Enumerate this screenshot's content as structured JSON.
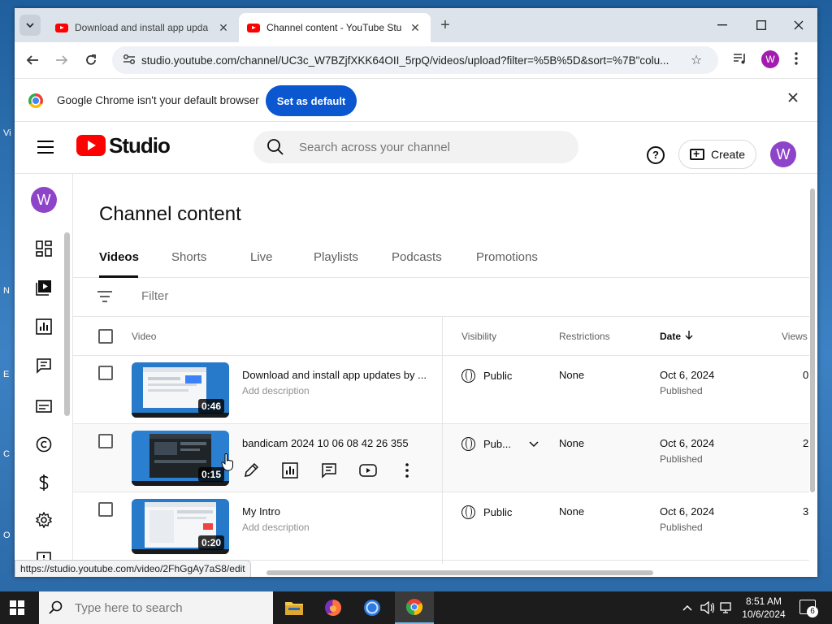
{
  "browser": {
    "tabs": [
      {
        "title": "Download and install app upda"
      },
      {
        "title": "Channel content - YouTube Stu"
      }
    ],
    "url": "studio.youtube.com/channel/UC3c_W7BZjfXKK64OII_5rpQ/videos/upload?filter=%5B%5D&sort=%7B\"colu...",
    "profile_letter": "W",
    "infobar": {
      "message": "Google Chrome isn't your default browser",
      "button": "Set as default"
    },
    "status_url": "https://studio.youtube.com/video/2FhGgAy7aS8/edit"
  },
  "studio": {
    "brand": "Studio",
    "search_placeholder": "Search across your channel",
    "create_label": "Create",
    "avatar_letter": "W"
  },
  "content": {
    "title": "Channel content",
    "tabs": [
      "Videos",
      "Shorts",
      "Live",
      "Playlists",
      "Podcasts",
      "Promotions"
    ],
    "filter_placeholder": "Filter",
    "columns": {
      "video": "Video",
      "visibility": "Visibility",
      "restrictions": "Restrictions",
      "date": "Date",
      "views": "Views"
    },
    "rows": [
      {
        "title": "Download and install app updates by ...",
        "description": "Add description",
        "duration": "0:46",
        "visibility": "Public",
        "restrictions": "None",
        "date": "Oct 6, 2024",
        "status": "Published",
        "views": "0"
      },
      {
        "title": "bandicam 2024 10 06 08 42 26 355",
        "description": "",
        "duration": "0:15",
        "visibility": "Pub...",
        "restrictions": "None",
        "date": "Oct 6, 2024",
        "status": "Published",
        "views": "2"
      },
      {
        "title": "My Intro",
        "description": "Add description",
        "duration": "0:20",
        "visibility": "Public",
        "restrictions": "None",
        "date": "Oct 6, 2024",
        "status": "Published",
        "views": "3"
      }
    ]
  },
  "taskbar": {
    "search_placeholder": "Type here to search",
    "time": "8:51 AM",
    "date": "10/6/2024",
    "notifications": "6"
  },
  "colors": {
    "youtube_red": "#ff0000",
    "chrome_blue": "#0b57d0",
    "avatar": "#8e44c9"
  }
}
